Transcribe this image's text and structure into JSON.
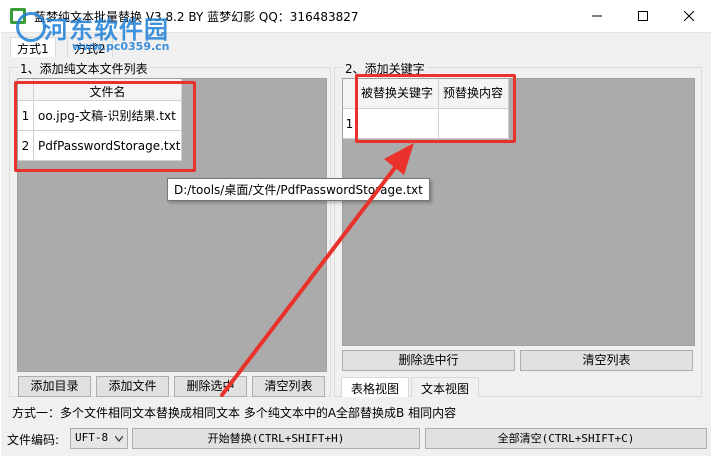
{
  "window": {
    "title": "蓝梦纯文本批量替换 V3.8.2 BY 蓝梦幻影 QQ：316483827"
  },
  "watermark": {
    "text": "河东软件园",
    "url": "www.pc0359.cn"
  },
  "tabs": {
    "mode1": "方式1",
    "mode2": "方式2"
  },
  "files_group": {
    "title": "1、添加纯文本文件列表",
    "column_header": "文件名",
    "rows": [
      {
        "num": "1",
        "name": "oo.jpg-文稿-识别结果.txt"
      },
      {
        "num": "2",
        "name": "PdfPasswordStorage.txt"
      }
    ],
    "tooltip": "D:/tools/桌面/文件/PdfPasswordStorage.txt",
    "buttons": {
      "add_dir": "添加目录",
      "add_file": "添加文件",
      "delete_selected": "删除选中",
      "clear_list": "清空列表"
    }
  },
  "keywords_group": {
    "title": "2、添加关键字",
    "columns": [
      "被替换关键字",
      "预替换内容"
    ],
    "row_num": "1",
    "buttons": {
      "delete_row": "删除选中行",
      "clear_list": "清空列表"
    },
    "view_tabs": {
      "table": "表格视图",
      "text": "文本视图"
    }
  },
  "status": {
    "description": "方式一：多个文件相同文本替换成相同文本   多个纯文本中的A全部替换成B  相同内容"
  },
  "bottom": {
    "encoding_label": "文件编码:",
    "encoding_value": "UFT-8",
    "start_button": "开始替换(CTRL+SHIFT+H)",
    "clear_all_button": "全部清空(CTRL+SHIFT+C)"
  },
  "colors": {
    "annotation_red": "#e8322b",
    "watermark_blue": "#1e7fd6"
  }
}
